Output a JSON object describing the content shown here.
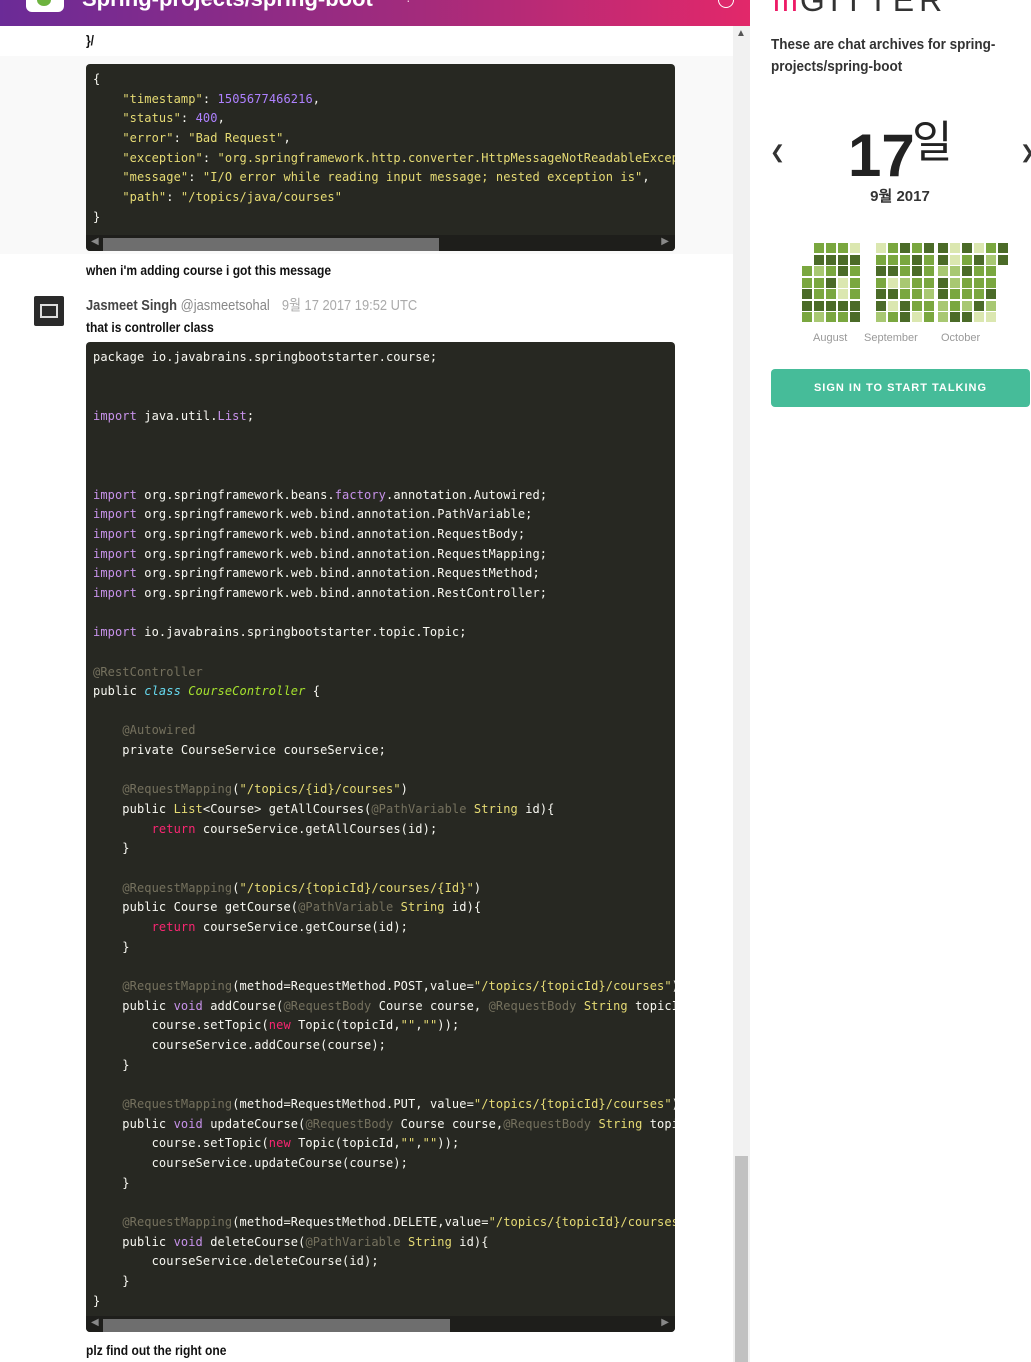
{
  "header": {
    "title": "Spring-projects/spring-boot",
    "accent": "#e2286a"
  },
  "messages": {
    "prev_tail": "}/",
    "json_code": [
      "{",
      "    <span class=\"y\">\"timestamp\"</span>: <span class=\"n\">1505677466216</span>,",
      "    <span class=\"y\">\"status\"</span>: <span class=\"n\">400</span>,",
      "    <span class=\"y\">\"error\"</span>: <span class=\"s\">\"Bad Request\"</span>,",
      "    <span class=\"y\">\"exception\"</span>: <span class=\"s\">\"org.springframework.http.converter.HttpMessageNotReadableException\"</span>,",
      "    <span class=\"y\">\"message\"</span>: <span class=\"s\">\"I/O error while reading input message; nested exception is\"</span>,",
      "    <span class=\"y\">\"path\"</span>: <span class=\"s\">\"/topics/java/courses\"</span>",
      "}"
    ],
    "msg1": "when i'm adding course i got this message",
    "author_name": "Jasmeet Singh",
    "author_username": "@jasmeetsohal",
    "timestamp": "9월 17 2017 19:52 UTC",
    "msg2": "that is controller class",
    "java_code": [
      "package io.javabrains.springbootstarter.course;",
      "",
      "",
      "<span class=\"k\">import</span> java.util.<span class=\"k\">List</span>;",
      "",
      "",
      "",
      "<span class=\"k\">import</span> org.springframework.beans.<span class=\"k\">factory</span>.annotation.Autowired;",
      "<span class=\"k\">import</span> org.springframework.web.bind.annotation.PathVariable;",
      "<span class=\"k\">import</span> org.springframework.web.bind.annotation.RequestBody;",
      "<span class=\"k\">import</span> org.springframework.web.bind.annotation.RequestMapping;",
      "<span class=\"k\">import</span> org.springframework.web.bind.annotation.RequestMethod;",
      "<span class=\"k\">import</span> org.springframework.web.bind.annotation.RestController;",
      "",
      "<span class=\"k\">import</span> io.javabrains.springbootstarter.topic.Topic;",
      "",
      "<span class=\"a\">@RestController</span>",
      "public <span class=\"c\">class</span> <span class=\"g\">CourseController</span> {",
      "",
      "    <span class=\"a\">@Autowired</span>",
      "    private CourseService courseService;",
      "",
      "    <span class=\"a\">@RequestMapping</span>(<span class=\"s\">\"/topics/{id}/courses\"</span>)",
      "    public <span class=\"y\">List</span>&lt;Course&gt; getAllCourses(<span class=\"a\">@PathVariable</span> <span class=\"y\">String</span> id){",
      "        <span class=\"r\">return</span> courseService.getAllCourses(id);",
      "    }",
      "",
      "    <span class=\"a\">@RequestMapping</span>(<span class=\"s\">\"/topics/{topicId}/courses/{Id}\"</span>)",
      "    public Course getCourse(<span class=\"a\">@PathVariable</span> <span class=\"y\">String</span> id){",
      "        <span class=\"r\">return</span> courseService.getCourse(id);",
      "    }",
      "",
      "    <span class=\"a\">@RequestMapping</span>(method=RequestMethod.POST,value=<span class=\"s\">\"/topics/{topicId}/courses\"</span>)",
      "    public <span class=\"k\">void</span> addCourse(<span class=\"a\">@RequestBody</span> Course course, <span class=\"a\">@RequestBody</span> <span class=\"y\">String</span> topicId){",
      "        course.setTopic(<span class=\"r\">new</span> Topic(topicId,<span class=\"s\">\"\"</span>,<span class=\"s\">\"\"</span>));",
      "        courseService.addCourse(course);",
      "    }",
      "",
      "    <span class=\"a\">@RequestMapping</span>(method=RequestMethod.PUT, value=<span class=\"s\">\"/topics/{topicId}/courses\"</span>)",
      "    public <span class=\"k\">void</span> updateCourse(<span class=\"a\">@RequestBody</span> Course course,<span class=\"a\">@RequestBody</span> <span class=\"y\">String</span> topicId){",
      "        course.setTopic(<span class=\"r\">new</span> Topic(topicId,<span class=\"s\">\"\"</span>,<span class=\"s\">\"\"</span>));",
      "        courseService.updateCourse(course);",
      "    }",
      "",
      "    <span class=\"a\">@RequestMapping</span>(method=RequestMethod.DELETE,value=<span class=\"s\">\"/topics/{topicId}/courses\"</span>)",
      "    public <span class=\"k\">void</span> deleteCourse(<span class=\"a\">@PathVariable</span> <span class=\"y\">String</span> id){",
      "        courseService.deleteCourse(id);",
      "    }",
      "}"
    ],
    "msg3": "plz find out the right one"
  },
  "sidebar": {
    "logo_text": "GITTER",
    "description": "These are chat archives for spring-projects/spring-boot",
    "day": "17",
    "day_suffix": "일",
    "month_year": "9월 2017",
    "months": [
      "August",
      "September",
      "October"
    ],
    "signin_label": "SIGN IN TO START TALKING",
    "signin_color": "#46bc99",
    "heat_colors": [
      "#4b6b28",
      "#7aa73f",
      "#a8c872",
      "#dbe7b0"
    ]
  }
}
